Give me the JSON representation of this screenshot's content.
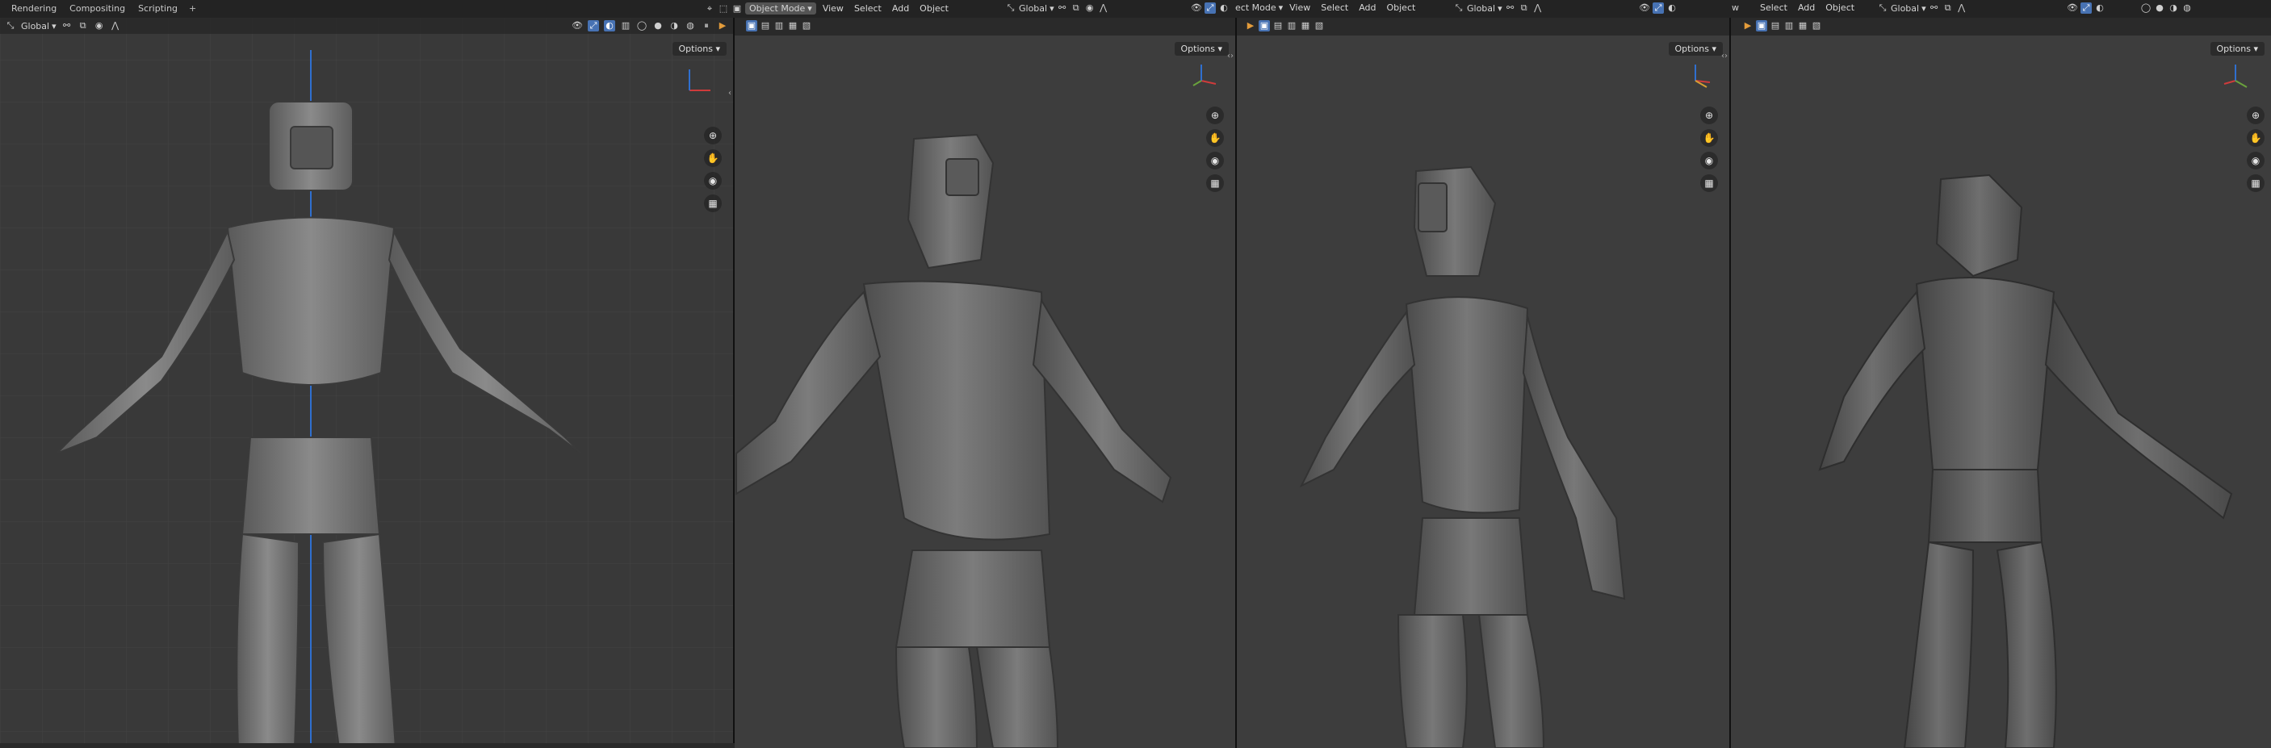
{
  "workspace_tabs": [
    "Rendering",
    "Compositing",
    "Scripting"
  ],
  "workspace_add": "+",
  "viewports": [
    {
      "name": "front-ortho",
      "header": {
        "orientation": "Global"
      },
      "options": "Options",
      "grid": true,
      "figure_color": "#7a7a7a"
    },
    {
      "name": "perspective-2",
      "header": {
        "mode": "Object Mode",
        "menus": [
          "View",
          "Select",
          "Add",
          "Object"
        ],
        "orientation": "Global"
      },
      "options": "Options"
    },
    {
      "name": "perspective-3",
      "header": {
        "mode": "ect Mode",
        "menus": [
          "View",
          "Select",
          "Add",
          "Object"
        ],
        "orientation": "Global"
      },
      "options": "Options"
    },
    {
      "name": "perspective-4",
      "header": {
        "mode": "w",
        "menus": [
          "Select",
          "Add",
          "Object"
        ],
        "orientation": "Global"
      },
      "options": "Options"
    }
  ],
  "nav_icons": [
    "zoom-icon",
    "hand-pan-icon",
    "camera-icon",
    "grid-icon"
  ],
  "colors": {
    "accent": "#4772b3",
    "bg": "#3d3d3d",
    "grid": "#4a4a4a",
    "axis_blue": "#2f6fcf",
    "axis_red": "#cf3b3b",
    "axis_green": "#6aa23c"
  }
}
